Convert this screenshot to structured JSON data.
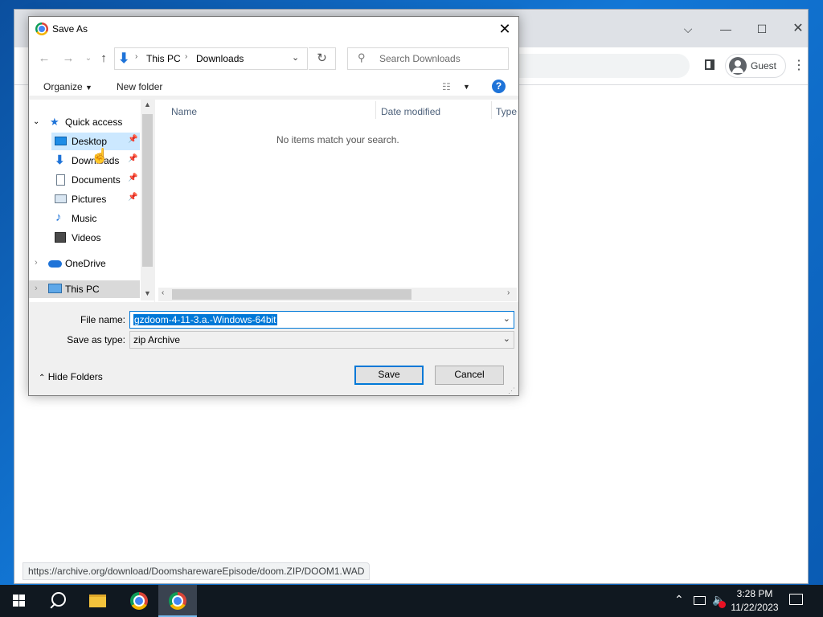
{
  "browser": {
    "profile_label": "Guest",
    "status_url": "https://archive.org/download/DoomsharewareEpisode/doom.ZIP/DOOM1.WAD"
  },
  "dialog": {
    "title": "Save As",
    "breadcrumb": [
      "This PC",
      "Downloads"
    ],
    "search_placeholder": "Search Downloads",
    "organize_label": "Organize",
    "new_folder_label": "New folder",
    "columns": [
      "Name",
      "Date modified",
      "Type"
    ],
    "empty_message": "No items match your search.",
    "tree": {
      "quick_access": "Quick access",
      "items": [
        {
          "label": "Desktop",
          "icon": "desktop-icon",
          "pinned": true
        },
        {
          "label": "Downloads",
          "icon": "downloads-icon",
          "pinned": true
        },
        {
          "label": "Documents",
          "icon": "documents-icon",
          "pinned": true
        },
        {
          "label": "Pictures",
          "icon": "pictures-icon",
          "pinned": true
        },
        {
          "label": "Music",
          "icon": "music-icon",
          "pinned": false
        },
        {
          "label": "Videos",
          "icon": "videos-icon",
          "pinned": false
        }
      ],
      "onedrive": "OneDrive",
      "this_pc": "This PC"
    },
    "file_name_label": "File name:",
    "file_name_value": "gzdoom-4-11-3.a.-Windows-64bit",
    "save_type_label": "Save as type:",
    "save_type_value": "zip Archive",
    "hide_folders_label": "Hide Folders",
    "save_label": "Save",
    "cancel_label": "Cancel"
  },
  "taskbar": {
    "time": "3:28 PM",
    "date": "11/22/2023"
  },
  "colors": {
    "accent": "#0078d7",
    "taskbar": "#101820"
  }
}
